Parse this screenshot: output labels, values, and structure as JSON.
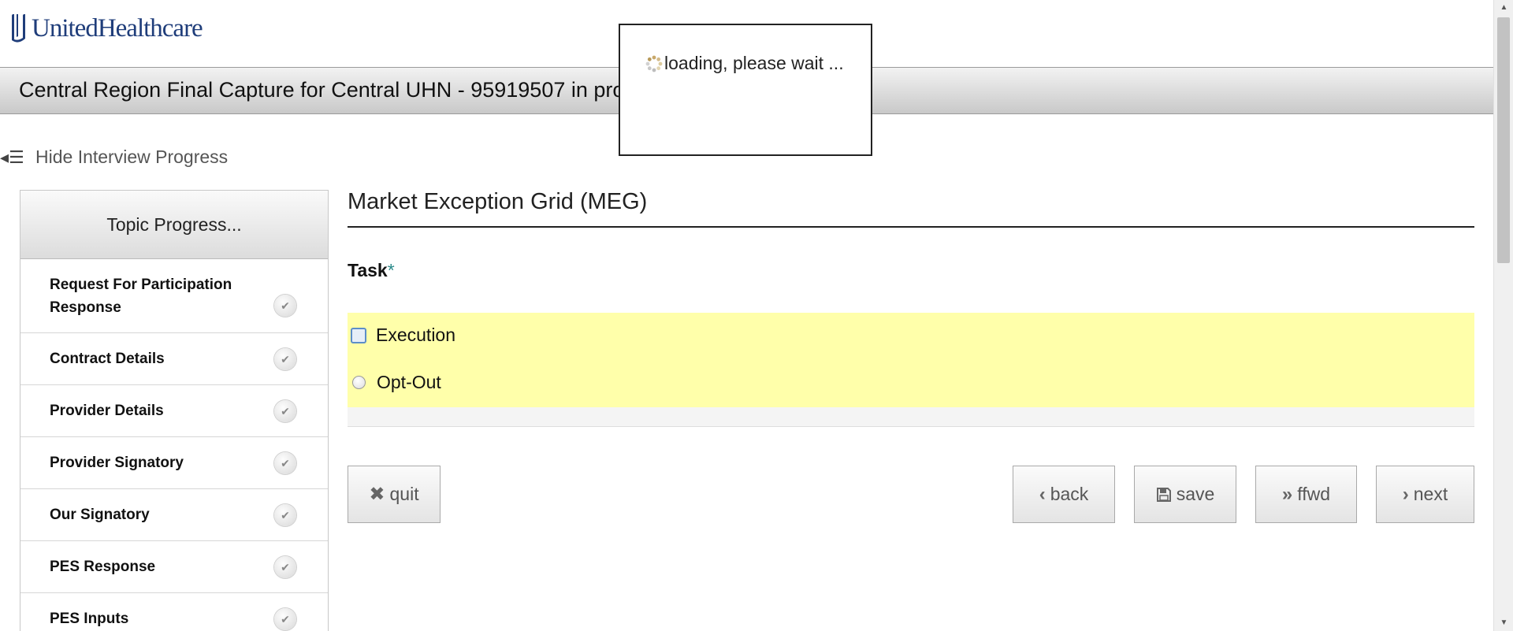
{
  "brand": {
    "logo_text": "UnitedHealthcare",
    "color": "#1f3d7a"
  },
  "title_bar": {
    "title": "Central Region Final Capture for Central UHN - 95919507 in pro"
  },
  "loading": {
    "message": "loading, please wait ..."
  },
  "progress_toggle": {
    "icon": "menu-collapse-icon",
    "label": "Hide Interview Progress"
  },
  "sidebar": {
    "header": "Topic Progress...",
    "items": [
      {
        "label": "Request For Participation Response",
        "status": "complete"
      },
      {
        "label": "Contract Details",
        "status": "complete"
      },
      {
        "label": "Provider Details",
        "status": "complete"
      },
      {
        "label": "Provider Signatory",
        "status": "complete"
      },
      {
        "label": "Our Signatory",
        "status": "complete"
      },
      {
        "label": "PES Response",
        "status": "complete"
      },
      {
        "label": "PES Inputs",
        "status": "complete"
      }
    ]
  },
  "main": {
    "title": "Market Exception Grid (MEG)",
    "task_label": "Task",
    "required_marker": "*",
    "options": [
      {
        "label": "Execution",
        "selected": false,
        "focused": true
      },
      {
        "label": "Opt-Out",
        "selected": false,
        "focused": false
      }
    ],
    "highlight_color": "#ffffaa"
  },
  "buttons": {
    "quit": "quit",
    "back": "back",
    "save": "save",
    "ffwd": "ffwd",
    "next": "next"
  }
}
